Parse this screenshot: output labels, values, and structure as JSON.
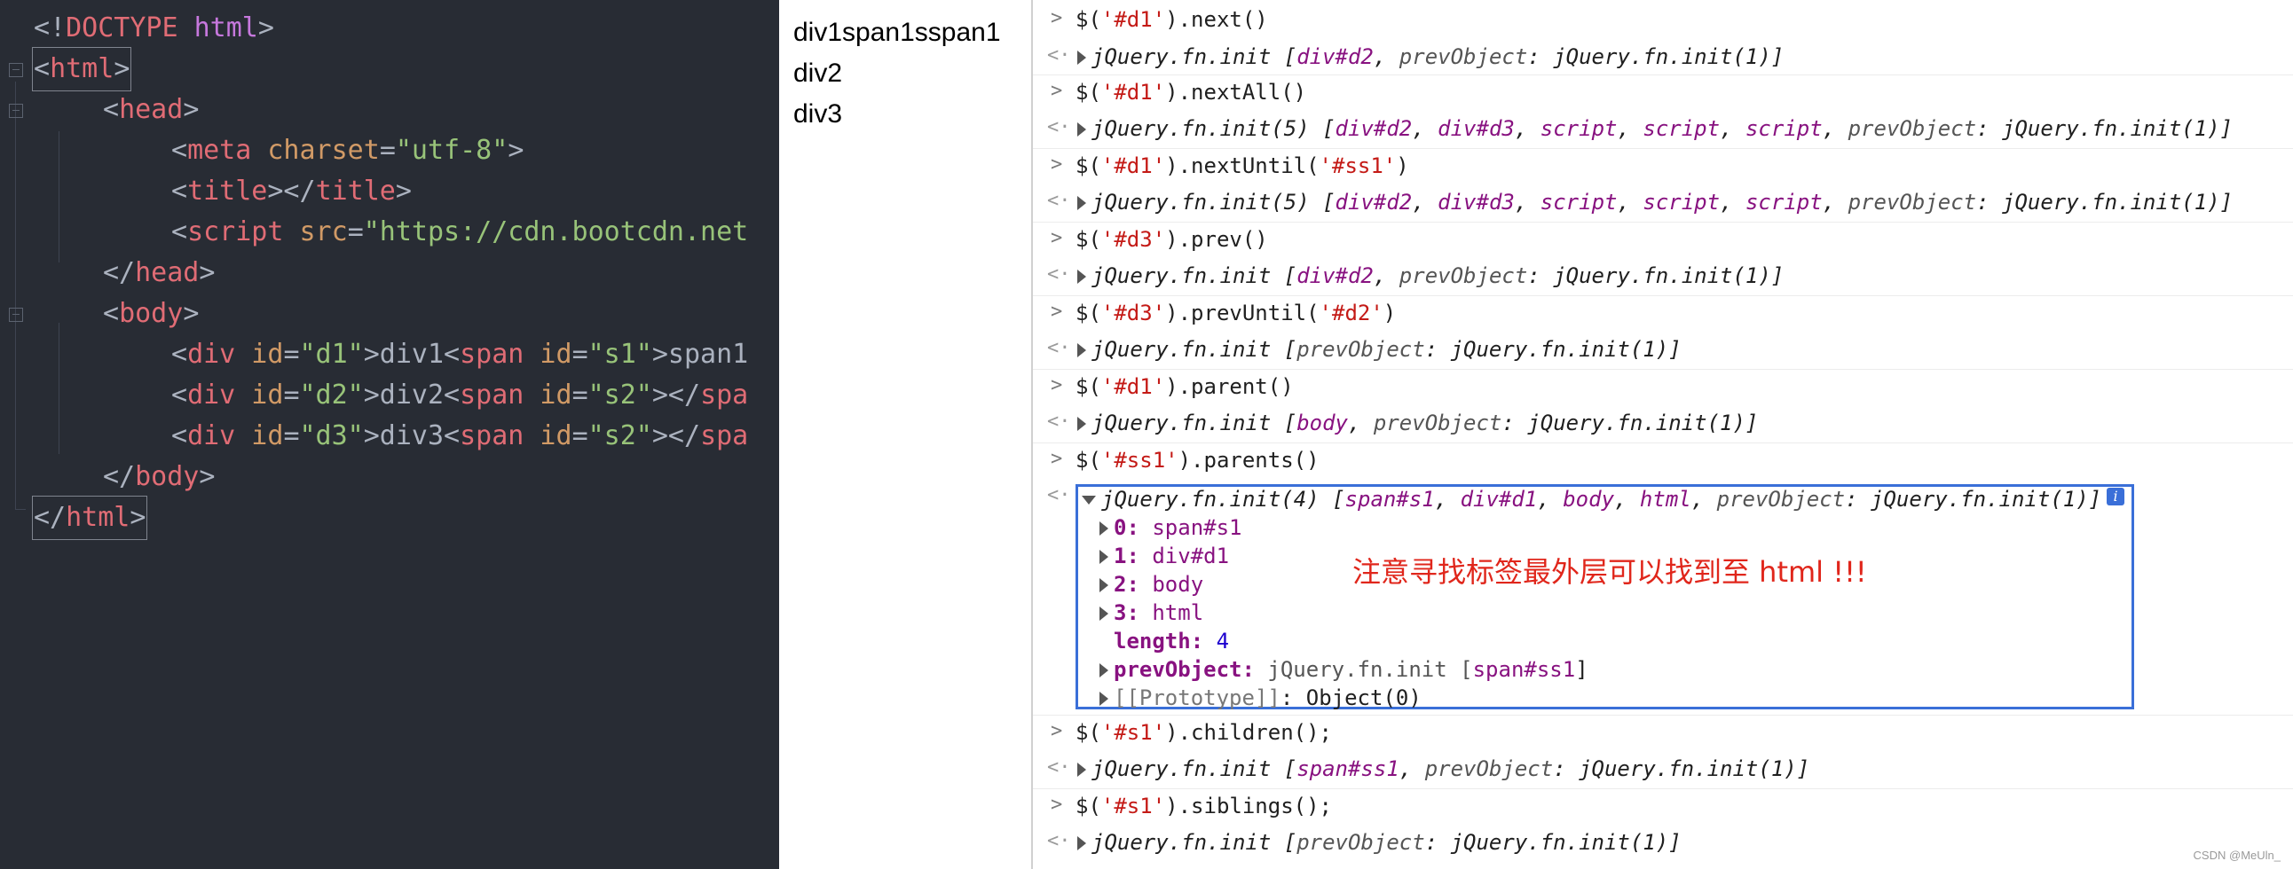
{
  "editor": {
    "lines": [
      [
        "<!",
        "DOCTYPE",
        " html",
        ">"
      ],
      [
        "<",
        "html",
        ">"
      ],
      [
        "<",
        "head",
        ">"
      ],
      [
        "<",
        "meta",
        " charset",
        "=",
        "\"utf-8\"",
        ">"
      ],
      [
        "<",
        "title",
        "></",
        "title",
        ">"
      ],
      [
        "<",
        "script",
        " src",
        "=",
        "\"https://cdn.bootcdn.net"
      ],
      [
        "</",
        "head",
        ">"
      ],
      [
        "<",
        "body",
        ">"
      ],
      [
        "<",
        "div",
        " id",
        "=",
        "\"d1\"",
        ">div1<",
        "span",
        " id",
        "=",
        "\"s1\"",
        ">span1"
      ],
      [
        "<",
        "div",
        " id",
        "=",
        "\"d2\"",
        ">div2<",
        "span",
        " id",
        "=",
        "\"s2\"",
        "></",
        "spa"
      ],
      [
        "<",
        "div",
        " id",
        "=",
        "\"d3\"",
        ">div3<",
        "span",
        " id",
        "=",
        "\"s2\"",
        "></",
        "spa"
      ],
      [
        "</",
        "body",
        ">"
      ],
      [
        "</",
        "html",
        ">"
      ]
    ]
  },
  "render": {
    "lines": [
      "div1span1sspan1",
      "div2",
      "div3"
    ]
  },
  "console": {
    "entries": [
      {
        "cmd": [
          "$(",
          "'#d1'",
          ").next()"
        ],
        "res": [
          "jQuery.fn.init [",
          "div#d2",
          ", ",
          "prevObject",
          ": jQuery.fn.init(1)]"
        ]
      },
      {
        "cmd": [
          "$(",
          "'#d1'",
          ").nextAll()"
        ],
        "res": [
          "jQuery.fn.init(5) [",
          "div#d2",
          ", ",
          "div#d3",
          ", ",
          "script",
          ", ",
          "script",
          ", ",
          "script",
          ", ",
          "prevObject",
          ": jQuery.fn.init(1)]"
        ]
      },
      {
        "cmd": [
          "$(",
          "'#d1'",
          ").nextUntil(",
          "'#ss1'",
          ")"
        ],
        "res": [
          "jQuery.fn.init(5) [",
          "div#d2",
          ", ",
          "div#d3",
          ", ",
          "script",
          ", ",
          "script",
          ", ",
          "script",
          ", ",
          "prevObject",
          ": jQuery.fn.init(1)]"
        ]
      },
      {
        "cmd": [
          "$(",
          "'#d3'",
          ").prev()"
        ],
        "res": [
          "jQuery.fn.init [",
          "div#d2",
          ", ",
          "prevObject",
          ": jQuery.fn.init(1)]"
        ]
      },
      {
        "cmd": [
          "$(",
          "'#d3'",
          ").prevUntil(",
          "'#d2'",
          ")"
        ],
        "res": [
          "jQuery.fn.init [",
          "prevObject",
          ": jQuery.fn.init(1)]"
        ]
      },
      {
        "cmd": [
          "$(",
          "'#d1'",
          ").parent()"
        ],
        "res": [
          "jQuery.fn.init [",
          "body",
          ", ",
          "prevObject",
          ": jQuery.fn.init(1)]"
        ]
      },
      {
        "cmd": [
          "$(",
          "'#ss1'",
          ").parents()"
        ],
        "res": [
          "jQuery.fn.init(4) [",
          "span#s1",
          ", ",
          "div#d1",
          ", ",
          "body",
          ", ",
          "html",
          ", ",
          "prevObject",
          ": jQuery.fn.init(1)]"
        ]
      },
      {
        "cmd": [
          "$(",
          "'#s1'",
          ").children();"
        ],
        "res": [
          "jQuery.fn.init [",
          "span#ss1",
          ", ",
          "prevObject",
          ": jQuery.fn.init(1)]"
        ]
      },
      {
        "cmd": [
          "$(",
          "'#s1'",
          ").siblings();"
        ],
        "res": [
          "jQuery.fn.init [",
          "prevObject",
          ": jQuery.fn.init(1)]"
        ]
      }
    ],
    "expanded": {
      "props": [
        {
          "key": "0",
          "val": "span#s1"
        },
        {
          "key": "1",
          "val": "div#d1"
        },
        {
          "key": "2",
          "val": "body"
        },
        {
          "key": "3",
          "val": "html"
        }
      ],
      "length_key": "length",
      "length_val": "4",
      "prev_key": "prevObject",
      "prev_val": "jQuery.fn.init [",
      "prev_el": "span#ss1",
      "prev_end": "]",
      "proto_key": "[[Prototype]]",
      "proto_val": ": Object(0)"
    },
    "annotation": "注意寻找标签最外层可以找到至 html !!!",
    "info_icon": "i"
  },
  "watermark": "CSDN @MeUln_"
}
